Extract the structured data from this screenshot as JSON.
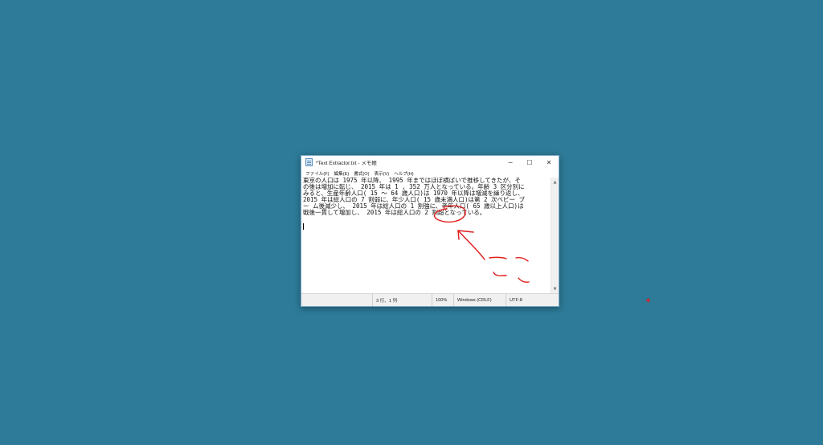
{
  "window": {
    "title": "*Text Extractor.txt - メモ帳",
    "controls": {
      "minimize": "─",
      "maximize": "☐",
      "close": "✕"
    }
  },
  "menu": [
    "ファイル(F)",
    "編集(E)",
    "書式(O)",
    "表示(V)",
    "ヘルプ(H)"
  ],
  "editor": {
    "lines": [
      "東京の人口は 1975 年以降、 1995 年まではほぼ横ばいで推移してきたが、そ",
      "の後は増加に転じ、 2015 年は 1 , 352 万人となっている。年齢 3 区分別に",
      "みると、生産年齢人口( 15 ～ 64 歳人口)は 1970 年以降は増減を繰り返し、",
      "2015 年は総人口の 7 割弱に、年少人口( 15 歳未満人口)は第 2 次ベビー ブ",
      "ー ム後減少し、 2015 年は総人口の 1 割強に、老年人口( 65 歳以上人口)は",
      "戦後一貫して増加し、 2015 年は総人口の 2 割超となっている。"
    ]
  },
  "statusbar": {
    "position": "3 行、1 列",
    "zoom": "100%",
    "line_ending": "Windows (CRLF)",
    "encoding": "UTF-8"
  },
  "colors": {
    "desktop": "#2d7b98",
    "annotation": "#e21b1b"
  }
}
